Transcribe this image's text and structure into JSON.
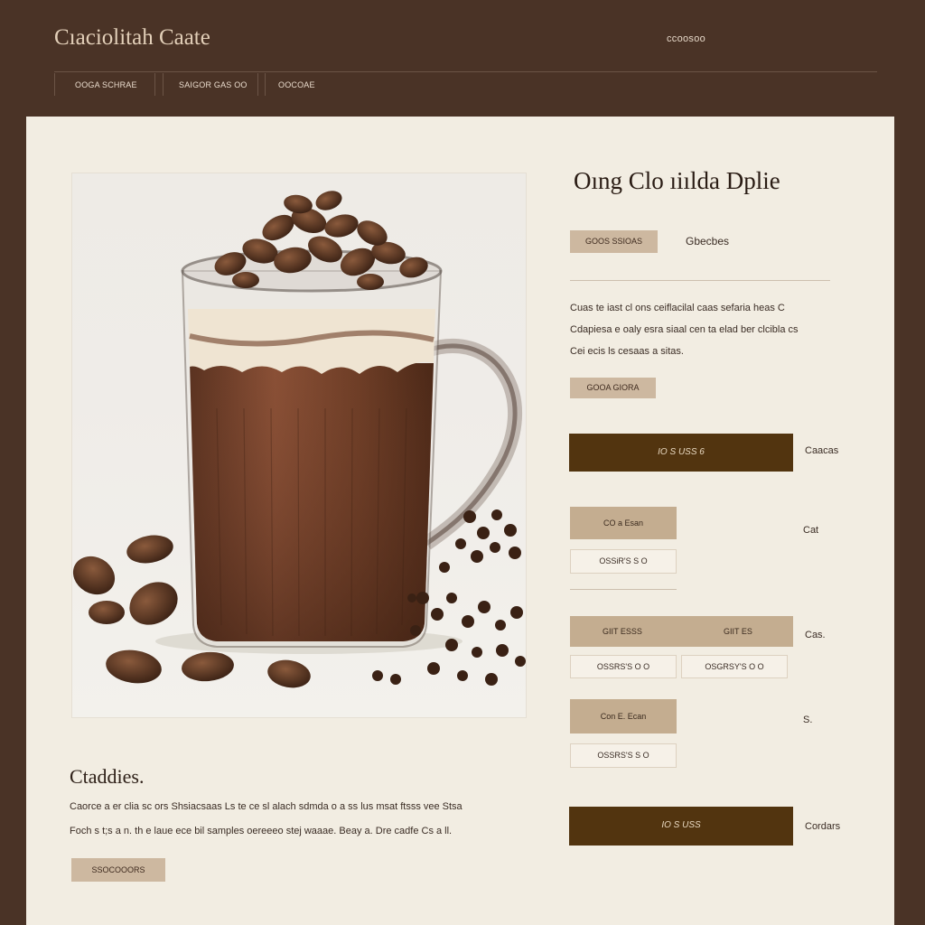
{
  "header": {
    "brand": "Cıaciolitah Caate",
    "link": "ccoosoo",
    "nav": [
      "OOGA SCHRAE",
      "SAIGOR GAS OO",
      "OOCOAE"
    ]
  },
  "left": {
    "section_title": "Ctaddies.",
    "body_lines": [
      "Caorce a er clia sc ors Shsiacsaas  Ls  te ce sl alach  sdmda  o a ss lus msat  ftsss  vee Stsa",
      "Foch  s  t;s  a  n.  th  e  laue  ece bil  samples  oereeeo  stej  waaae.  Beay  a.  Dre  cadfe  Cs  a  ll."
    ],
    "button": "SSOCOOORS"
  },
  "right": {
    "title": "Oıng  Clo ıiılda Dplie",
    "tag_button": "GOOS SSIOAS",
    "tag_label": "Gbecbes",
    "desc_lines": [
      "Cuas  te  iast cl ons ceiflacilal  caas sefaria heas  C",
      "Cdapiesa e oaly esra siaal cen ta elad ber clcibla cs",
      "Cei  ecis ls cesaas a sitas."
    ],
    "desc_button": "GOOA GIORA",
    "cta1": {
      "label": "IO  S  USS 6",
      "side": "Caacas"
    },
    "opt1": {
      "head": "CO a Esan",
      "box": "OSSiR'S  S  O",
      "side": "Cat"
    },
    "opt2": {
      "head_a": "GIIT ESSS",
      "head_b": "GIIT ES",
      "box_a": "OSSRS'S  O  O",
      "box_b": "OSGRSY'S  O  O",
      "side": "Cas."
    },
    "opt3": {
      "head": "Con  E. Ecan",
      "box": "OSSRS'S  S  O",
      "side": "S."
    },
    "cta2": {
      "label": "IO  S  USS",
      "side": "Cordars"
    }
  },
  "colors": {
    "frame": "#4a3326",
    "panel": "#f2ede2",
    "accent_dark": "#52340f",
    "accent_light": "#cdb8a0"
  }
}
